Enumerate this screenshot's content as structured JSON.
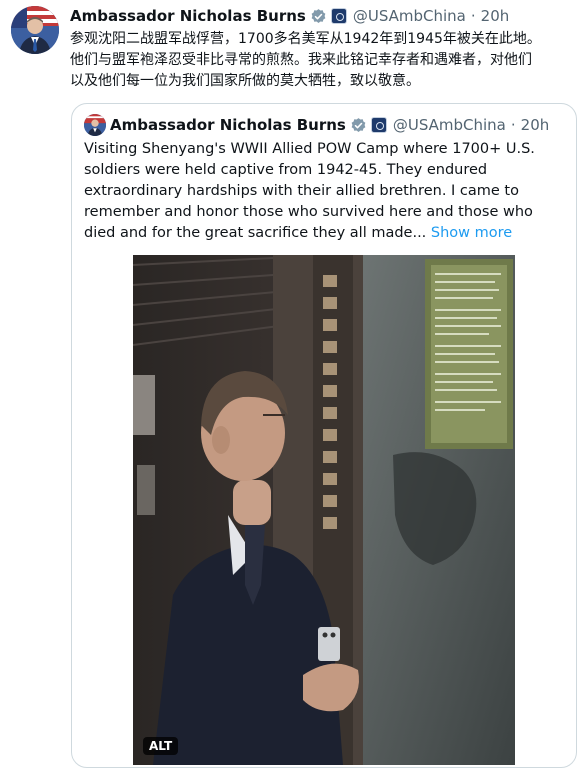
{
  "tweet": {
    "author_name": "Ambassador Nicholas Burns",
    "handle": "@USAmbChina",
    "separator": "·",
    "time": "20h",
    "text_lines": [
      "参观沈阳二战盟军战俘营，1700多名美军从1942年到1945年被关在此地。",
      "他们与盟军袍泽忍受非比寻常的煎熬。我来此铭记幸存者和遇难者，对他们",
      "以及他们每一位为我们国家所做的莫大牺牲，致以敬意。"
    ]
  },
  "quoted": {
    "author_name": "Ambassador Nicholas Burns",
    "handle": "@USAmbChina",
    "separator": "·",
    "time": "20h",
    "text": "Visiting Shenyang's WWII Allied POW Camp where 1700+ U.S. soldiers were held captive from 1942-45.  They endured extraordinary hardships with their allied brethren.  I came to remember and honor those who survived here and those who died and for the great sacrifice they all made... ",
    "show_more": "Show more",
    "alt_badge": "ALT"
  },
  "icons": {
    "verified": "verified-check-icon",
    "gov_badge": "us-government-seal-icon"
  },
  "colors": {
    "link": "#1d9bf0",
    "secondary_text": "#536471",
    "border": "#cfd9de",
    "verified": "#1d9bf0"
  }
}
